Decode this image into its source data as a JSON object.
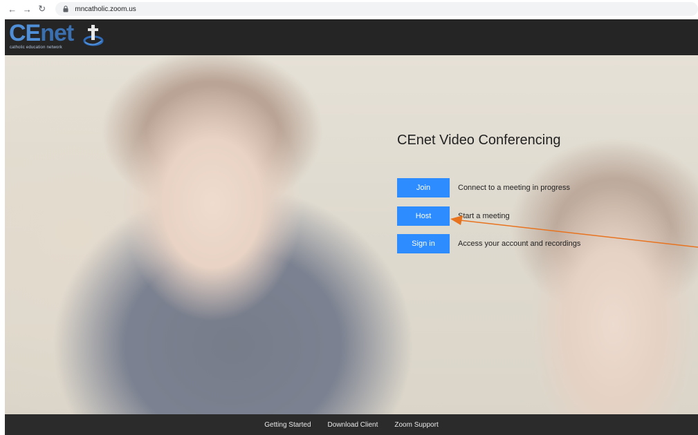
{
  "browser": {
    "url": "mncatholic.zoom.us",
    "back_icon": "arrow-left-icon",
    "forward_icon": "arrow-right-icon",
    "reload_icon": "reload-icon",
    "lock_icon": "lock-icon"
  },
  "header": {
    "logo_text_ce": "CE",
    "logo_text_net": "net",
    "logo_subtitle": "catholic education network",
    "logo_icon": "cenet-logo-mark-icon"
  },
  "main": {
    "title": "CEnet Video Conferencing",
    "actions": [
      {
        "label": "Join",
        "description": "Connect to a meeting in progress"
      },
      {
        "label": "Host",
        "description": "Start a meeting"
      },
      {
        "label": "Sign in",
        "description": "Access your account and recordings"
      }
    ],
    "accent_color": "#2d8cff",
    "annotation_arrow_color": "#e8731e"
  },
  "footer": {
    "links": [
      "Getting Started",
      "Download Client",
      "Zoom Support"
    ]
  }
}
